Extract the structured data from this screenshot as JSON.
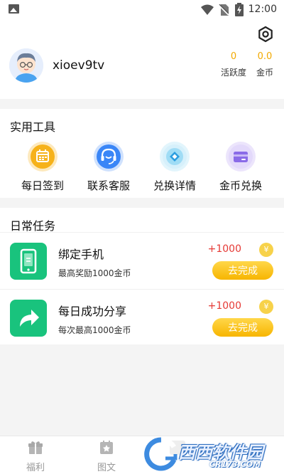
{
  "status_bar": {
    "time": "12:00"
  },
  "header": {
    "username": "xioev9tv",
    "stats": [
      {
        "value": "0",
        "label": "活跃度"
      },
      {
        "value": "0.0",
        "label": "金币"
      }
    ]
  },
  "tools": {
    "title": "实用工具",
    "items": [
      {
        "label": "每日签到",
        "icon": "calendar-icon",
        "color": "#f6b21a"
      },
      {
        "label": "联系客服",
        "icon": "headset-icon",
        "color": "#3a86f7"
      },
      {
        "label": "兑换详情",
        "icon": "diamond-icon",
        "color": "#5cc8f2"
      },
      {
        "label": "金币兑换",
        "icon": "card-icon",
        "color": "#8a6be8"
      }
    ]
  },
  "tasks": {
    "title": "日常任务",
    "items": [
      {
        "name": "绑定手机",
        "desc": "最高奖励1000金币",
        "reward": "+1000",
        "coin": "¥",
        "button": "去完成",
        "icon": "phone-icon"
      },
      {
        "name": "每日成功分享",
        "desc": "每次最高1000金币",
        "reward": "+1000",
        "coin": "¥",
        "button": "去完成",
        "icon": "share-icon"
      }
    ]
  },
  "bottom_nav": {
    "items": [
      {
        "label": "福利",
        "icon": "gift-icon"
      },
      {
        "label": "图文",
        "icon": "article-icon"
      }
    ]
  },
  "watermark": {
    "text_cn": "西西软件园",
    "text_en": "CR173.COM"
  },
  "colors": {
    "accent_yellow": "#f7b500",
    "reward_red": "#e53935",
    "task_green": "#19c37d"
  }
}
